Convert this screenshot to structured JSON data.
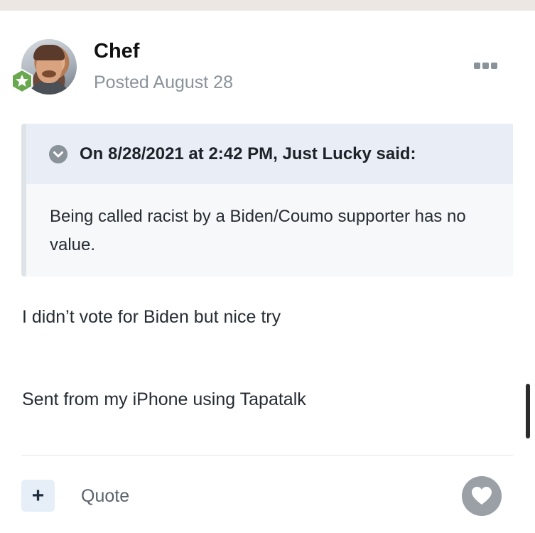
{
  "post": {
    "author": "Chef",
    "posted": "Posted August 28",
    "quote": {
      "citation": "On 8/28/2021 at 2:42 PM, Just Lucky said:",
      "text": "Being called racist by a Biden/Coumo supporter has no value."
    },
    "body": "I didn’t vote for Biden but nice try",
    "signature": "Sent from my iPhone using Tapatalk"
  },
  "footer": {
    "plus_label": "+",
    "quote_label": "Quote"
  },
  "icons": {
    "rank_badge": "star-badge-icon",
    "menu": "more-options-icon",
    "quote_toggle": "chevron-down-circle-icon",
    "like": "heart-icon"
  },
  "colors": {
    "top_strip": "#ece7e2",
    "quote_header": "#e9edf5",
    "quote_background": "#f7f8fa",
    "muted_text": "#8a929a",
    "badge_green": "#6aa84f",
    "like_button": "#9aa0a6"
  }
}
